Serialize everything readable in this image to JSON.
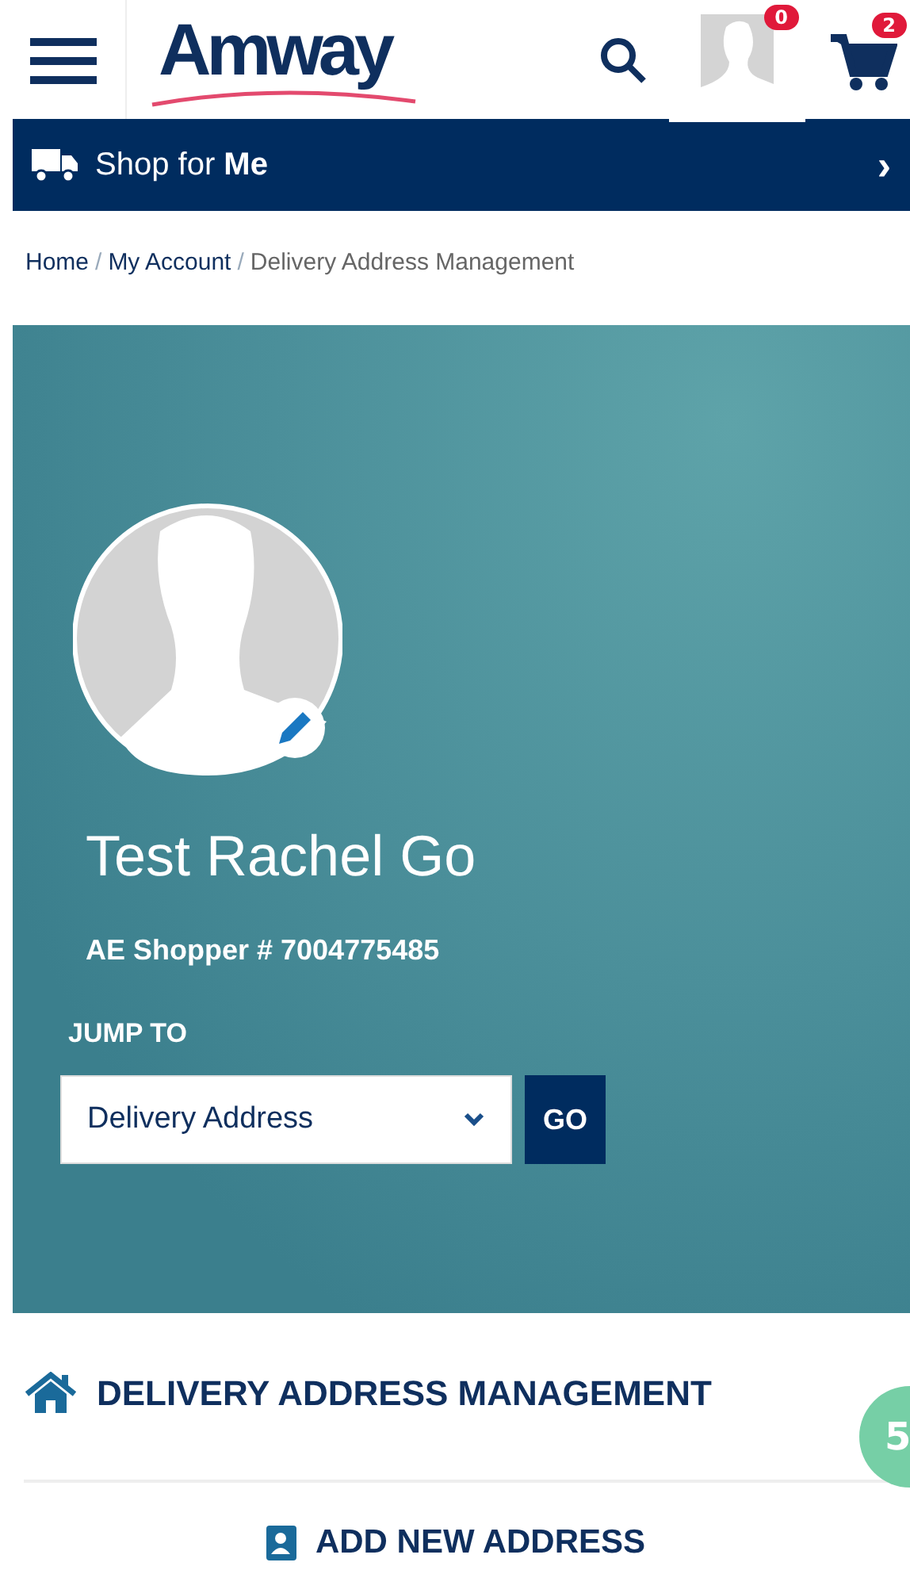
{
  "header": {
    "logo": "Amway",
    "wishlist_count": "0",
    "cart_count": "2"
  },
  "shop_bar": {
    "label": "Shop for ",
    "label_bold": "Me",
    "arrow": "›"
  },
  "breadcrumb_separator": "/",
  "breadcrumb": [
    {
      "label": "Home",
      "kind": "link"
    },
    {
      "label": "My Account",
      "kind": "link"
    },
    {
      "label": "Delivery Address Management",
      "kind": "current"
    }
  ],
  "profile": {
    "name": "Test Rachel Go",
    "shopper_id": "AE Shopper # 7004775485",
    "jump_label": "JUMP TO",
    "jump_value": "Delivery Address",
    "go_button": "GO"
  },
  "section": {
    "title": "DELIVERY ADDRESS MANAGEMENT",
    "step_badge": "5",
    "add_button": "ADD NEW ADDRESS"
  }
}
